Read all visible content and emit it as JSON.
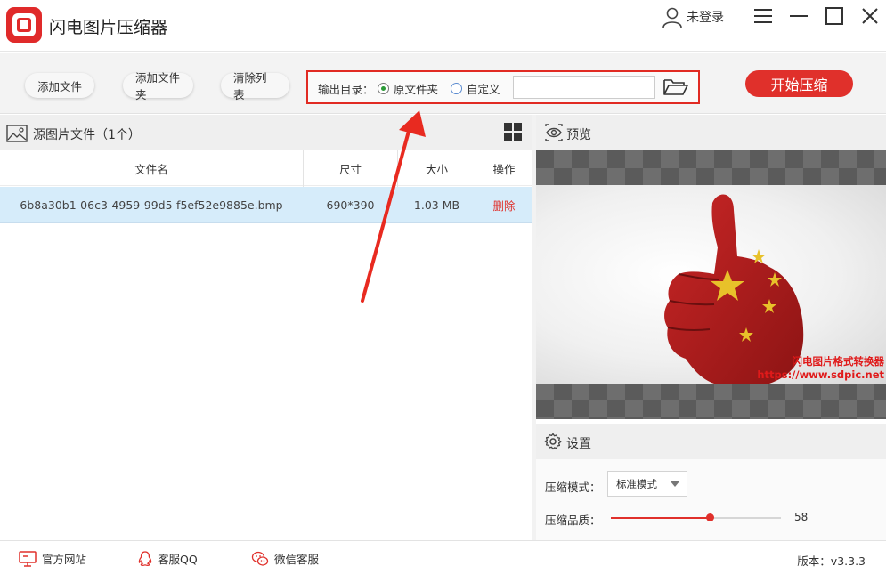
{
  "app": {
    "title": "闪电图片压缩器",
    "user_label": "未登录"
  },
  "toolbar": {
    "add_file": "添加文件",
    "add_folder": "添加文件夹",
    "clear_list": "清除列表",
    "output_label": "输出目录：",
    "radio_original": "原文件夹",
    "radio_custom": "自定义",
    "selected_output": "原文件夹",
    "path_value": "",
    "start_button": "开始压缩"
  },
  "left_panel": {
    "title": "源图片文件（1个）",
    "columns": [
      "文件名",
      "尺寸",
      "大小",
      "操作"
    ],
    "rows": [
      {
        "filename": "6b8a30b1-06c3-4959-99d5-f5ef52e9885e.bmp",
        "dimensions": "690*390",
        "size": "1.03 MB",
        "action": "删除"
      }
    ]
  },
  "preview": {
    "title": "预览",
    "watermark_line1": "闪电图片格式转换器",
    "watermark_line2": "https://www.sdpic.net"
  },
  "settings": {
    "title": "设置",
    "mode_label": "压缩模式：",
    "mode_value": "标准模式",
    "quality_label": "压缩品质：",
    "quality_value": "58",
    "quality_fraction": 0.58
  },
  "footer": {
    "website": "官方网站",
    "qq": "客服QQ",
    "wechat": "微信客服",
    "version": "版本：v3.3.3"
  },
  "colors": {
    "accent": "#e0302b",
    "selected_row": "#d6ecfa",
    "radio_checked": "#2b9a37"
  }
}
